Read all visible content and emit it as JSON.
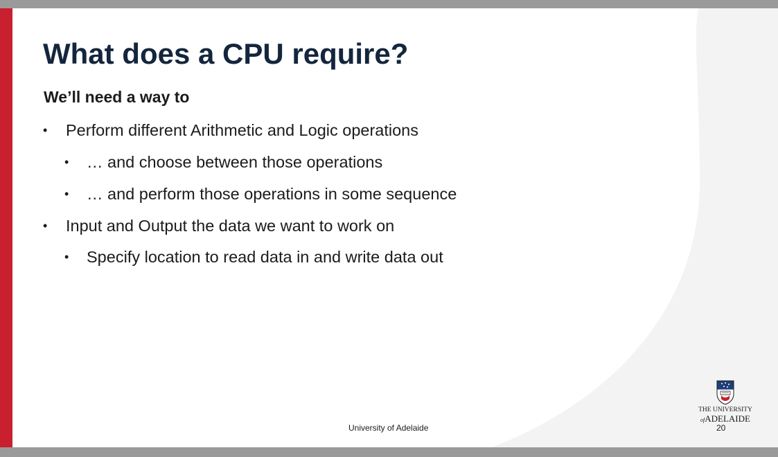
{
  "slide": {
    "title": "What does a CPU require?",
    "subtitle": "We’ll need a way to",
    "bullets": [
      {
        "text": "Perform different Arithmetic and Logic operations"
      },
      {
        "text": "… and choose between those operations"
      },
      {
        "text": "… and perform those operations in some sequence"
      },
      {
        "text": "Input and Output the data we want to work on"
      },
      {
        "text": "Specify location to read data in and write data out"
      }
    ],
    "bullet_glyph": "•",
    "footer": "University of Adelaide",
    "page_number": "20"
  },
  "logo": {
    "line1": "THE UNIVERSITY",
    "line2_prefix": "of",
    "line2_name": "ADELAIDE"
  },
  "colors": {
    "accent_red": "#c8202f",
    "title_navy": "#14263d",
    "outer_frame_gray": "#9a9a9a",
    "background_tint": "#f3f3f4"
  }
}
